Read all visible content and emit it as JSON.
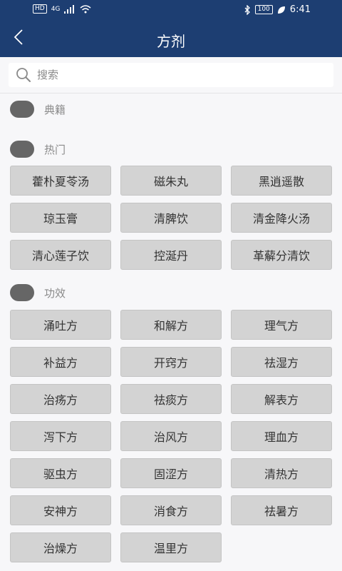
{
  "status_bar": {
    "hd": "HD",
    "network": "4G",
    "battery": "100",
    "time": "6:41"
  },
  "header": {
    "title": "方剂"
  },
  "search": {
    "placeholder": "搜索"
  },
  "sections": {
    "classics": {
      "label": "典籍"
    },
    "popular": {
      "label": "热门",
      "items": [
        "藿朴夏苓汤",
        "磁朱丸",
        "黑逍遥散",
        "琼玉膏",
        "清脾饮",
        "清金降火汤",
        "清心莲子饮",
        "控涎丹",
        "革薢分清饮"
      ]
    },
    "efficacy": {
      "label": "功效",
      "items": [
        "涌吐方",
        "和解方",
        "理气方",
        "补益方",
        "开窍方",
        "祛湿方",
        "治疡方",
        "祛痰方",
        "解表方",
        "泻下方",
        "治风方",
        "理血方",
        "驱虫方",
        "固涩方",
        "清热方",
        "安神方",
        "消食方",
        "祛暑方",
        "治燥方",
        "温里方"
      ]
    }
  },
  "colors": {
    "header_bg": "#1d3e72",
    "button_bg": "#d3d3d3",
    "section_dot": "#666666"
  }
}
